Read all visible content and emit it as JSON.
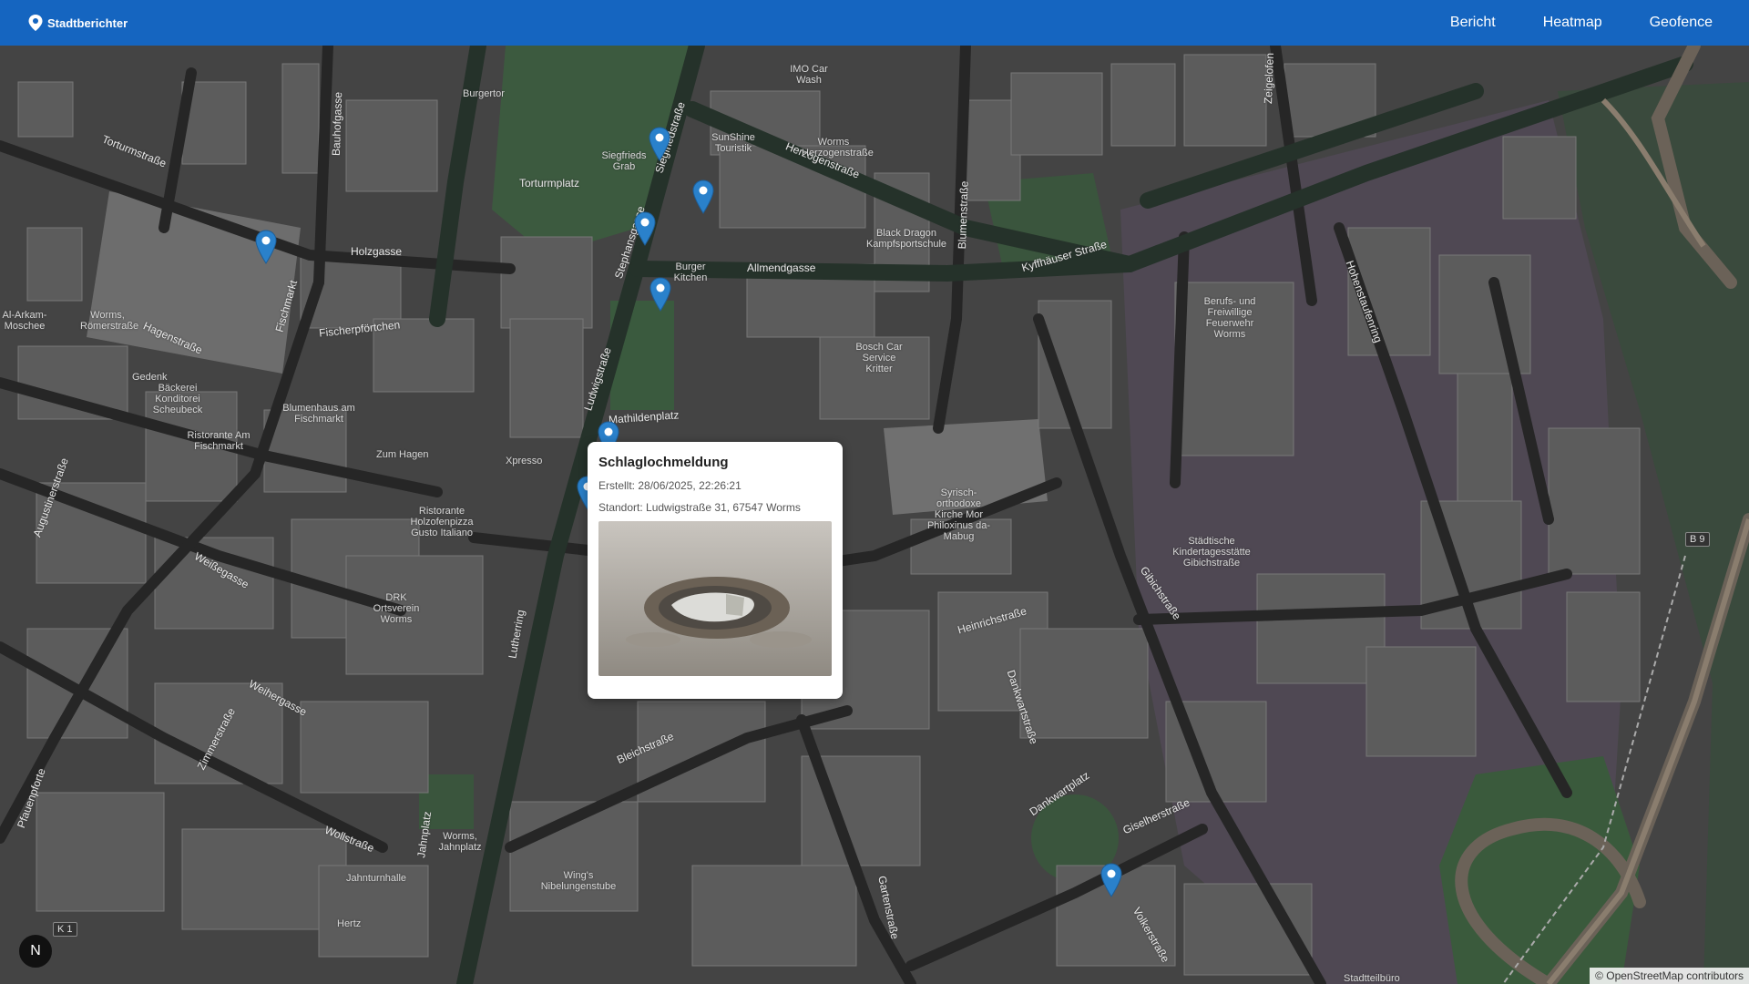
{
  "navbar": {
    "brand": "Stadtberichter",
    "links": [
      "Bericht",
      "Heatmap",
      "Geofence"
    ],
    "color": "#1565c0"
  },
  "map": {
    "streets": [
      "Torturmstraße",
      "Holzgasse",
      "Fischerpförtchen",
      "Hagenstraße",
      "Allmendgasse",
      "Herzogenstraße",
      "Kyffhäuser Straße",
      "Ludwigstraße",
      "Mathildenplatz",
      "Heinrichstraße",
      "Gibichstraße",
      "Hohenstaufenring",
      "Bleichstraße",
      "Weißegasse",
      "Weihergasse",
      "Wollstraße",
      "Gisel­herstraße",
      "Dankwartstraße",
      "Volkerstraße",
      "Gartenstraße",
      "Pfauenpforte",
      "Augustinerstraße",
      "Fischmarkt",
      "Bauhofgasse",
      "Stephansgasse",
      "Siegfriedstraße",
      "Blumenstraße",
      "Zeigelofen",
      "Dankwartplatz",
      "Jahnplatz",
      "Zimmerstraße",
      "Torturmplatz",
      "Lutherring"
    ],
    "pois": [
      "Burgertor",
      "IMO Car Wash",
      "SunShine Touristik",
      "Worms Herzogenstraße",
      "Siegfrieds Grab",
      "Black Dragon Kampfsportschule",
      "Burger Kitchen",
      "Bosch Car Service Kritter",
      "Berufs- und Freiwillige Feuerwehr Worms",
      "Syrisch-orthodoxe Kirche Mor Philoxinus da-Mabug",
      "Städtische Kindertagesstätte Gibichstraße",
      "Blumenhaus am Fischmarkt",
      "Bäckerei Konditorei Scheubeck",
      "Ristorante Am Fischmarkt",
      "Ristorante Holzofenpizza Gusto Italiano",
      "DRK Ortsverein Worms",
      "Xpresso",
      "Zum Hagen",
      "Gedenk",
      "Al-Arkam-Moschee",
      "Worms, Römerstraße",
      "Worms, Jahnplatz",
      "Wing's Nibelungenstube",
      "Jahnturnhalle",
      "Hertz",
      "Stadtteilbüro"
    ],
    "road_shields": [
      "B 9",
      "K 1"
    ]
  },
  "popup": {
    "title": "Schlaglochmeldung",
    "created": "Erstellt: 28/06/2025, 22:26:21",
    "location": "Standort: Ludwigstraße 31, 67547 Worms"
  },
  "compass": "N",
  "attribution": {
    "prefix": "© ",
    "link": "OpenStreetMap",
    "suffix": " contributors"
  },
  "marker_color": "#2a81cb"
}
